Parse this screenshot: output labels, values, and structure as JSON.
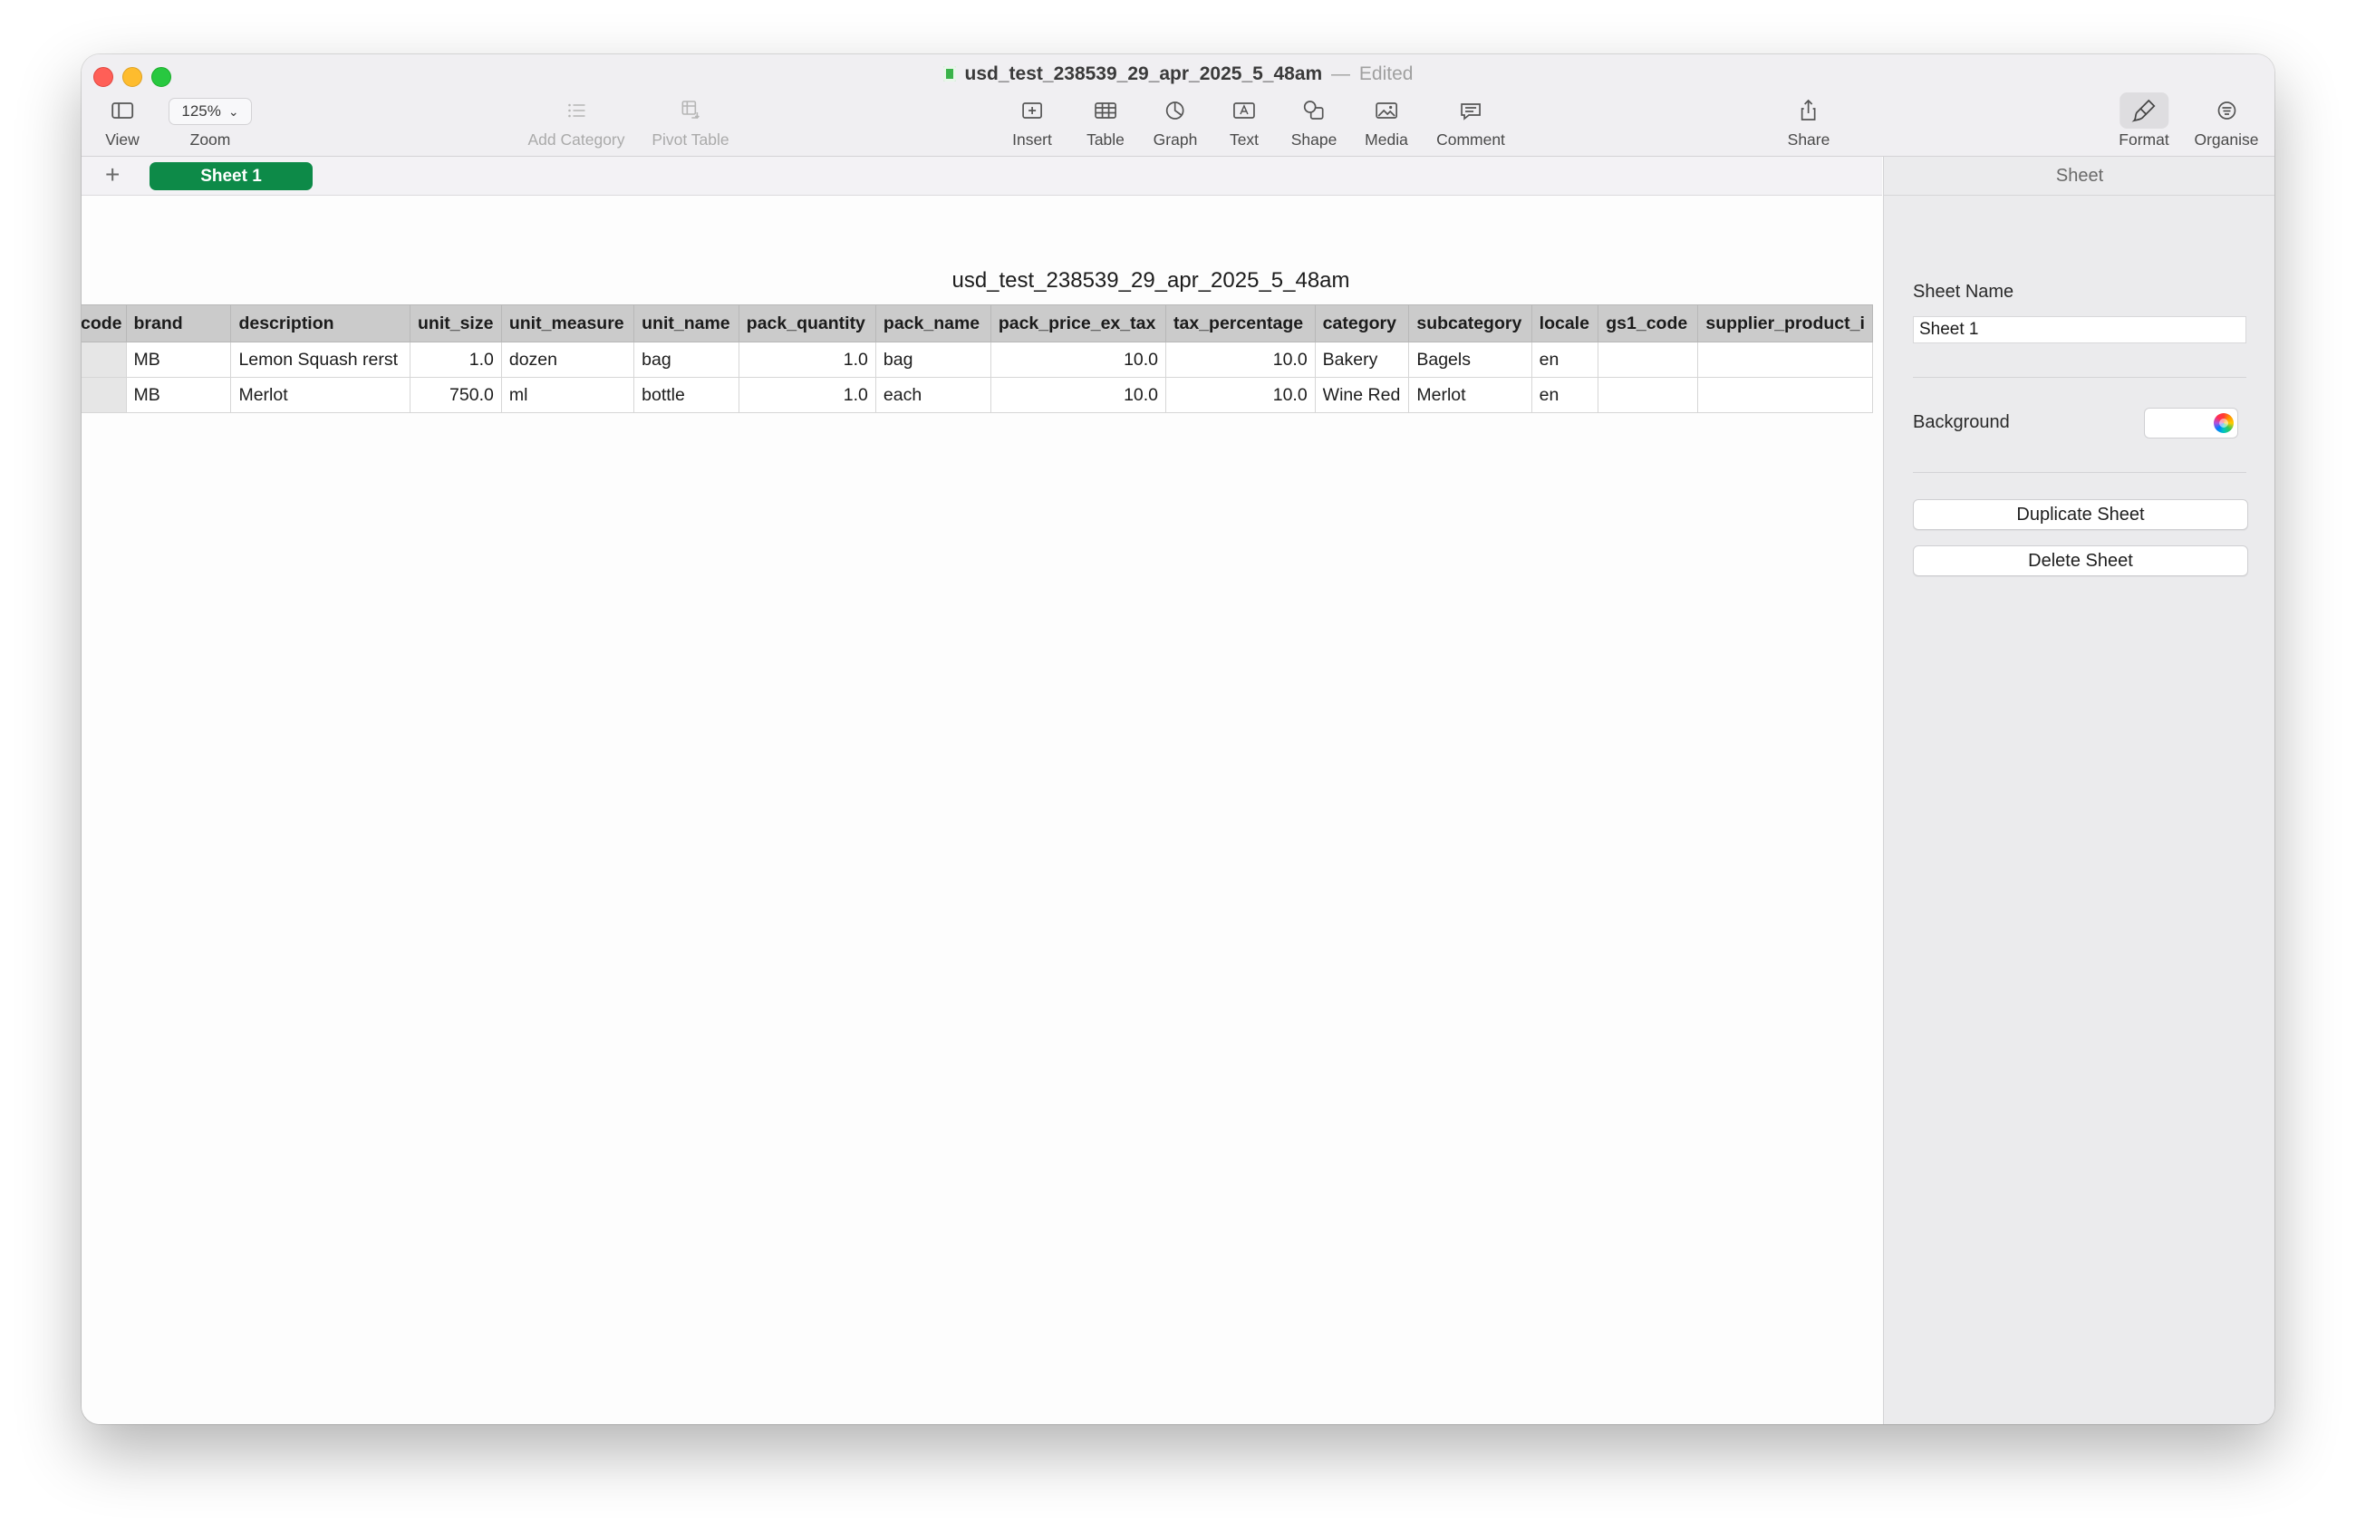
{
  "window": {
    "file_name": "usd_test_238539_29_apr_2025_5_48am",
    "separator": "—",
    "status": "Edited"
  },
  "toolbar": {
    "view_label": "View",
    "zoom_value": "125%",
    "zoom_label": "Zoom",
    "add_category_label": "Add Category",
    "pivot_table_label": "Pivot Table",
    "insert_label": "Insert",
    "table_label": "Table",
    "graph_label": "Graph",
    "text_label": "Text",
    "shape_label": "Shape",
    "media_label": "Media",
    "comment_label": "Comment",
    "share_label": "Share",
    "format_label": "Format",
    "organise_label": "Organise"
  },
  "tabs": {
    "add_symbol": "+",
    "sheets": [
      "Sheet 1"
    ]
  },
  "table": {
    "title": "usd_test_238539_29_apr_2025_5_48am",
    "columns": [
      "code",
      "brand",
      "description",
      "unit_size",
      "unit_measure",
      "unit_name",
      "pack_quantity",
      "pack_name",
      "pack_price_ex_tax",
      "tax_percentage",
      "category",
      "subcategory",
      "locale",
      "gs1_code",
      "supplier_product_i"
    ],
    "rows": [
      [
        "",
        "MB",
        "Lemon Squash rerst",
        "1.0",
        "dozen",
        "bag",
        "1.0",
        "bag",
        "10.0",
        "10.0",
        "Bakery",
        "Bagels",
        "en",
        "",
        ""
      ],
      [
        "",
        "MB",
        "Merlot",
        "750.0",
        "ml",
        "bottle",
        "1.0",
        "each",
        "10.0",
        "10.0",
        "Wine Red",
        "Merlot",
        "en",
        "",
        ""
      ]
    ]
  },
  "sidebar": {
    "header": "Sheet",
    "sheet_name_label": "Sheet Name",
    "sheet_name_value": "Sheet 1",
    "background_label": "Background",
    "background_color": "#ffffff",
    "duplicate_label": "Duplicate Sheet",
    "delete_label": "Delete Sheet"
  },
  "colors": {
    "accent_tab": "#0d8a48",
    "header_row": "#cbcbcb",
    "traffic_close": "#ff5f57",
    "traffic_min": "#febc2e",
    "traffic_max": "#28c840"
  }
}
